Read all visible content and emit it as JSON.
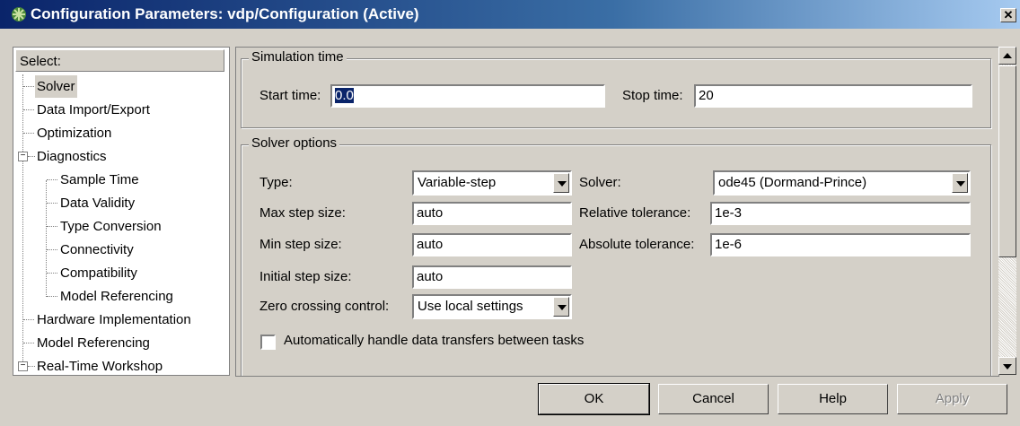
{
  "window": {
    "title": "Configuration Parameters: vdp/Configuration (Active)",
    "close_symbol": "✕"
  },
  "tree": {
    "header": "Select:",
    "items": [
      {
        "label": "Solver",
        "selected": true
      },
      {
        "label": "Data Import/Export"
      },
      {
        "label": "Optimization"
      },
      {
        "label": "Diagnostics",
        "expander": "−"
      },
      {
        "label": "Sample Time"
      },
      {
        "label": "Data Validity"
      },
      {
        "label": "Type Conversion"
      },
      {
        "label": "Connectivity"
      },
      {
        "label": "Compatibility"
      },
      {
        "label": "Model Referencing"
      },
      {
        "label": "Hardware Implementation"
      },
      {
        "label": "Model Referencing"
      },
      {
        "label": "Real-Time Workshop",
        "expander": "−"
      }
    ]
  },
  "simulation_time": {
    "title": "Simulation time",
    "start_label": "Start time:",
    "start_value": "0.0",
    "stop_label": "Stop time:",
    "stop_value": "20"
  },
  "solver_options": {
    "title": "Solver options",
    "type_label": "Type:",
    "type_value": "Variable-step",
    "solver_label": "Solver:",
    "solver_value": "ode45 (Dormand-Prince)",
    "max_step_label": "Max step size:",
    "max_step_value": "auto",
    "rel_tol_label": "Relative tolerance:",
    "rel_tol_value": "1e-3",
    "min_step_label": "Min step size:",
    "min_step_value": "auto",
    "abs_tol_label": "Absolute tolerance:",
    "abs_tol_value": "1e-6",
    "init_step_label": "Initial step size:",
    "init_step_value": "auto",
    "zero_cross_label": "Zero crossing control:",
    "zero_cross_value": "Use local settings",
    "auto_handle_label": "Automatically handle data transfers between tasks",
    "auto_handle_checked": false
  },
  "buttons": {
    "ok": "OK",
    "cancel": "Cancel",
    "help": "Help",
    "apply": "Apply"
  },
  "icons": {
    "title_icon": "simulink-config-icon",
    "close": "close-icon",
    "scroll_up": "scroll-up-arrow-icon",
    "scroll_down": "scroll-down-arrow-icon",
    "dropdown": "chevron-down-icon"
  },
  "colors": {
    "titlebar_start": "#0a246a",
    "titlebar_end": "#a6caf0",
    "dialog_bg": "#d4d0c8",
    "selection": "#0a246a"
  }
}
